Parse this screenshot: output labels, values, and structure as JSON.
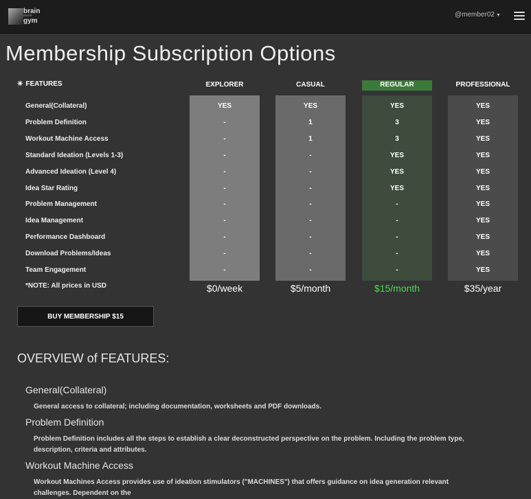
{
  "header": {
    "logo": {
      "line1": "brain",
      "line2": "storm",
      "line3": "gym"
    },
    "user": "@member02"
  },
  "page_title": "Membership Subscription Options",
  "table": {
    "features_label": "FEATURES",
    "columns": [
      {
        "name": "EXPLORER",
        "price": "$0/week"
      },
      {
        "name": "CASUAL",
        "price": "$5/month"
      },
      {
        "name": "REGULAR",
        "price": "$15/month"
      },
      {
        "name": "PROFESSIONAL",
        "price": "$35/year"
      }
    ],
    "rows": [
      {
        "feature": "General(Collateral)",
        "values": [
          "YES",
          "YES",
          "YES",
          "YES"
        ]
      },
      {
        "feature": "Problem Definition",
        "values": [
          "-",
          "1",
          "3",
          "YES"
        ]
      },
      {
        "feature": "Workout Machine Access",
        "values": [
          "-",
          "1",
          "3",
          "YES"
        ]
      },
      {
        "feature": "Standard Ideation (Levels 1-3)",
        "values": [
          "-",
          "-",
          "YES",
          "YES"
        ]
      },
      {
        "feature": "Advanced Ideation (Level 4)",
        "values": [
          "-",
          "-",
          "YES",
          "YES"
        ]
      },
      {
        "feature": "Idea Star Rating",
        "values": [
          "-",
          "-",
          "YES",
          "YES"
        ]
      },
      {
        "feature": "Problem Management",
        "values": [
          "-",
          "-",
          "-",
          "YES"
        ]
      },
      {
        "feature": "Idea Management",
        "values": [
          "-",
          "-",
          "-",
          "YES"
        ]
      },
      {
        "feature": "Performance Dashboard",
        "values": [
          "-",
          "-",
          "-",
          "YES"
        ]
      },
      {
        "feature": "Download Problems/Ideas",
        "values": [
          "-",
          "-",
          "-",
          "YES"
        ]
      },
      {
        "feature": "Team Engagement",
        "values": [
          "-",
          "-",
          "-",
          "YES"
        ]
      }
    ],
    "note": "*NOTE: All prices in USD"
  },
  "buy_button": "BUY MEMBERSHIP $15",
  "overview": {
    "title": "OVERVIEW of FEATURES:",
    "sections": [
      {
        "heading": "General(Collateral)",
        "text": "General access to collateral; including documentation, worksheets and PDF downloads."
      },
      {
        "heading": "Problem Definition",
        "text": "Problem Definition includes all the steps to establish a clear deconstructed perspective on the problem. Including the problem type, description, criteria and attributes."
      },
      {
        "heading": "Workout Machine Access",
        "text": "Workout Machines Access provides use of ideation stimulators (\"MACHINES\") that offers guidance on idea generation relevant challenges. Dependent on the"
      }
    ]
  },
  "colors": {
    "explorer_col": "#7d7d7d",
    "casual_col": "#6a6a6a",
    "regular_col": "#3d4c3d",
    "professional_col": "#4b4b4b",
    "highlight": "#3b7a3b",
    "price_highlight": "#4ddc4d"
  },
  "icons": {
    "features": "asterisk-icon",
    "menu": "hamburger-icon",
    "dropdown": "caret-down-icon"
  }
}
